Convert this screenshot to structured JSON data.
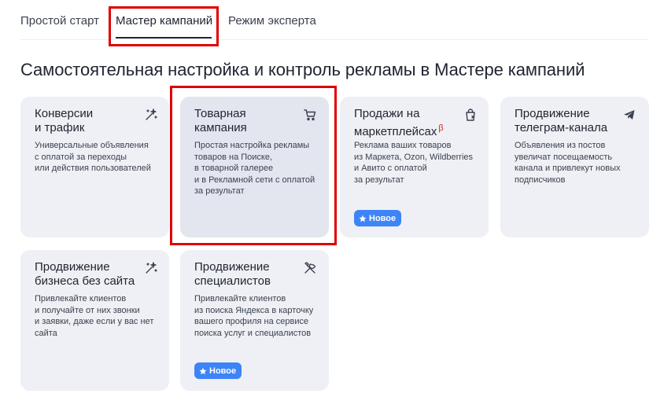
{
  "tabs": [
    {
      "label": "Простой старт"
    },
    {
      "label": "Мастер кампаний"
    },
    {
      "label": "Режим эксперта"
    }
  ],
  "page_title": "Самостоятельная настройка и контроль рекламы в Мастере кампаний",
  "cards": [
    {
      "title_lines": [
        "Конверсии",
        "и трафик"
      ],
      "icon": "magic-wand-icon",
      "desc_lines": [
        "Универсальные объявления",
        "с оплатой за переходы",
        "или действия пользователей"
      ]
    },
    {
      "title_lines": [
        "Товарная",
        "кампания"
      ],
      "icon": "shopping-cart-icon",
      "desc_lines": [
        "Простая настройка рекламы",
        "товаров на Поиске,",
        "в товарной галерее",
        "и в Рекламной сети с оплатой",
        "за результат"
      ]
    },
    {
      "title_lines": [
        "Продажи на",
        "маркетплейсах"
      ],
      "beta": "β",
      "icon": "shopping-bag-icon",
      "desc_lines": [
        "Реклама ваших товаров",
        "из Маркета, Ozon, Wildberries",
        "и Авито с оплатой",
        "за результат"
      ],
      "badge": "Новое"
    },
    {
      "title_lines": [
        "Продвижение",
        "телеграм-канала"
      ],
      "icon": "telegram-icon",
      "desc_lines": [
        "Объявления из постов",
        "увеличат посещаемость",
        "канала и привлекут новых",
        "подписчиков"
      ]
    },
    {
      "title_lines": [
        "Продвижение",
        "бизнеса без сайта"
      ],
      "icon": "magic-wand-icon",
      "desc_lines": [
        "Привлекайте клиентов",
        "и получайте от них звонки",
        "и заявки, даже если у вас нет",
        "сайта"
      ]
    },
    {
      "title_lines": [
        "Продвижение",
        "специалистов"
      ],
      "icon": "tools-icon",
      "desc_lines": [
        "Привлекайте клиентов",
        "из поиска Яндекса в карточку",
        "вашего профиля на сервисе",
        "поиска услуг и специалистов"
      ],
      "badge": "Новое"
    }
  ],
  "colors": {
    "card_bg": "#eef0f5",
    "card_selected_bg": "#e3e6ef",
    "badge_bg": "#3d84f7",
    "beta": "#e21b1b",
    "highlight": "#e00000"
  }
}
